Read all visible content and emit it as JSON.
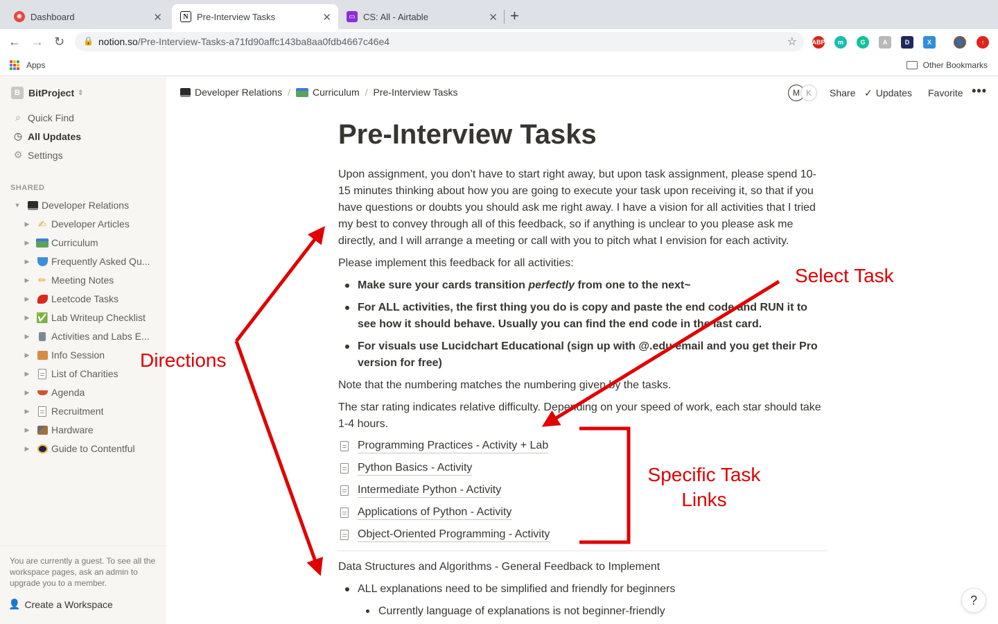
{
  "browser": {
    "tabs": [
      {
        "title": "Dashboard",
        "icon": "dashboard-favicon"
      },
      {
        "title": "Pre-Interview Tasks",
        "icon": "notion-favicon"
      },
      {
        "title": "CS: All - Airtable",
        "icon": "airtable-favicon"
      }
    ],
    "url_host": "notion.so",
    "url_path": "/Pre-Interview-Tasks-a71fd90affc143ba8aa0fdb4667c46e4",
    "bookmarks": {
      "apps": "Apps",
      "other": "Other Bookmarks"
    },
    "extensions": [
      {
        "label": "ABP",
        "color": "#d7261c"
      },
      {
        "label": "m",
        "color": "#19bdb1"
      },
      {
        "label": "G",
        "color": "#15c39a"
      },
      {
        "label": "A",
        "color": "#b9b9b9"
      },
      {
        "label": "D",
        "color": "#1e2b5a"
      },
      {
        "label": "X",
        "color": "#2f8ee0"
      }
    ]
  },
  "sidebar": {
    "workspace": "BitProject",
    "workspace_initial": "B",
    "nav": [
      "Quick Find",
      "All Updates",
      "Settings"
    ],
    "section_label": "SHARED",
    "root": {
      "label": "Developer Relations",
      "emoji": "laptop"
    },
    "items": [
      {
        "label": "Developer Articles",
        "emoji": "✍"
      },
      {
        "label": "Curriculum",
        "emoji": "car"
      },
      {
        "label": "Frequently Asked Qu...",
        "emoji": "bowl"
      },
      {
        "label": "Meeting Notes",
        "emoji": "✏"
      },
      {
        "label": "Leetcode Tasks",
        "emoji": "pepper"
      },
      {
        "label": "Lab Writeup Checklist",
        "emoji": "✅"
      },
      {
        "label": "Activities and Labs E...",
        "emoji": "microscope"
      },
      {
        "label": "Info Session",
        "emoji": "building"
      },
      {
        "label": "List of Charities",
        "emoji": "page"
      },
      {
        "label": "Agenda",
        "emoji": "boat"
      },
      {
        "label": "Recruitment",
        "emoji": "page"
      },
      {
        "label": "Hardware",
        "emoji": "hammer"
      },
      {
        "label": "Guide to Contentful",
        "emoji": "contentful"
      }
    ],
    "guest_note": "You are currently a guest. To see all the workspace pages, ask an admin to upgrade you to a member.",
    "create_workspace": "Create a Workspace"
  },
  "topbar": {
    "breadcrumbs": [
      "Developer Relations",
      "Curriculum",
      "Pre-Interview Tasks"
    ],
    "avatars": [
      "M",
      "K"
    ],
    "share": "Share",
    "updates": "Updates",
    "favorite": "Favorite",
    "more": "•••"
  },
  "page": {
    "title": "Pre-Interview Tasks",
    "intro": "Upon assignment, you don’t have to start right away, but upon task assignment, please spend 10-15 minutes thinking about how you are going to execute your task upon receiving it, so that if you have questions or doubts you should ask me right away. I have a vision for all activities that I tried my best to convey through all of this feedback, so if anything is unclear to you please ask me directly, and I will arrange a meeting or call with you to pitch what I envision for each activity.",
    "implement_heading": "Please implement this feedback for all activities:",
    "bullet1_pre": "Make sure your cards transition ",
    "bullet1_em": "perfectly",
    "bullet1_post": " from one to the next~",
    "bullet2": "For ALL activities, the first thing you do is copy and paste the end code and RUN it to see how it should behave. Usually you can find the end code in the last card.",
    "bullet3": "For visuals use Lucidchart Educational (sign up with @.edu email and you get their Pro version for free)",
    "numbering_note": "Note that the numbering matches the numbering given by the tasks.",
    "star_note": "The star rating indicates relative difficulty. Depending on your speed of work, each star should take 1-4 hours.",
    "links": [
      "Programming Practices - Activity + Lab",
      "Python Basics - Activity",
      "Intermediate Python - Activity",
      "Applications of Python - Activity",
      "Object-Oriented Programming - Activity"
    ],
    "ds_heading": "Data Structures and Algorithms - General Feedback to Implement",
    "ds_bullet": "ALL explanations need to be simplified and friendly for beginners",
    "ds_sub_bullet": "Currently language of explanations is not beginner-friendly",
    "help": "?"
  },
  "annotations": {
    "directions": "Directions",
    "select_task": "Select Task",
    "specific_task_links_line1": "Specific Task",
    "specific_task_links_line2": "Links",
    "color": "#e00000"
  }
}
